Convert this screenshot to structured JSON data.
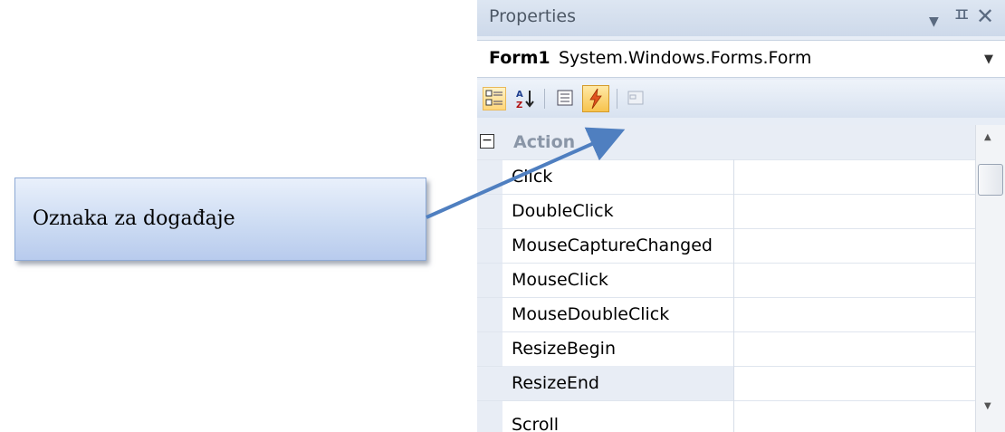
{
  "callout": {
    "text": "Oznaka za događaje"
  },
  "panel": {
    "title": "Properties",
    "object": {
      "name": "Form1",
      "type": "System.Windows.Forms.Form"
    },
    "toolbar": {
      "buttons": [
        "categorized",
        "alphabetical",
        "properties",
        "events",
        "property-pages"
      ],
      "active": "events"
    },
    "category": {
      "label": "Action",
      "expanded": true
    },
    "rows": [
      {
        "name": "Click",
        "value": ""
      },
      {
        "name": "DoubleClick",
        "value": ""
      },
      {
        "name": "MouseCaptureChanged",
        "value": ""
      },
      {
        "name": "MouseClick",
        "value": ""
      },
      {
        "name": "MouseDoubleClick",
        "value": ""
      },
      {
        "name": "ResizeBegin",
        "value": ""
      },
      {
        "name": "ResizeEnd",
        "value": ""
      },
      {
        "name": "Scroll",
        "value": ""
      }
    ]
  },
  "colors": {
    "callout_fill": "#cddcf3",
    "arrow": "#4f7fc0",
    "events_button": "#f7c34d"
  }
}
